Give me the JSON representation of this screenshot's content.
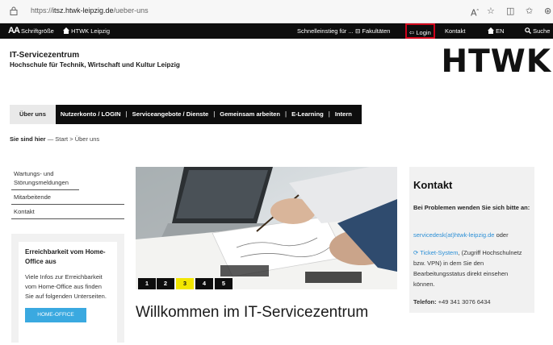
{
  "browser": {
    "url_prefix": "https://",
    "url_domain": "itsz.htwk-leipzig.de",
    "url_path": "/ueber-uns",
    "icons": [
      "lock-icon",
      "read-aloud-icon",
      "favorite-star-icon",
      "split-screen-icon",
      "favorites-icon",
      "extensions-icon"
    ]
  },
  "topbar": {
    "aa": "AA",
    "font_size_label": "Schriftgröße",
    "home_label": "HTWK Leipzig",
    "quick_start_label": "Schnelleinstieg für ...",
    "faculties_label": "Fakultäten",
    "login_label": "Login",
    "contact_label": "Kontakt",
    "language_label": "EN",
    "search_label": "Suche"
  },
  "header": {
    "title": "IT-Servicezentrum",
    "subtitle": "Hochschule für Technik, Wirtschaft und Kultur Leipzig",
    "logo_text": "HTWK"
  },
  "nav": {
    "items": [
      "Über uns",
      "Nutzerkonto / LOGIN",
      "Serviceangebote / Dienste",
      "Gemeinsam arbeiten",
      "E-Learning",
      "Intern"
    ],
    "separator": "|"
  },
  "breadcrumb": {
    "here": "Sie sind hier",
    "dash": "—",
    "start": "Start",
    "arrow": ">",
    "current": "Über uns"
  },
  "sidebar": {
    "links": [
      "Wartungs- und Störungsmeldungen",
      "Mitarbeitende",
      "Kontakt"
    ],
    "homeoffice": {
      "title": "Erreichbarkeit vom Home-Office aus",
      "text": "Viele Infos zur Erreichbarkeit vom Home-Office aus finden Sie auf folgenden Unterseiten.",
      "button": "HOME-OFFICE"
    }
  },
  "hero": {
    "slides": [
      "1",
      "2",
      "3",
      "4",
      "5"
    ],
    "active_slide": "3"
  },
  "main": {
    "heading": "Willkommen im IT-Servicezentrum"
  },
  "contact": {
    "title": "Kontakt",
    "lead": "Bei Problemen wenden Sie sich bitte an:",
    "email": "servicedesk(at)htwk-leipzig.de",
    "or": "oder",
    "ticket_link": "Ticket-System",
    "ticket_text": ", (Zugriff Hochschulnetz bzw. VPN) in dem Sie den Bearbeitungsstatus direkt einsehen können.",
    "phone_label": "Telefon:",
    "phone": "+49 341 3076 6434"
  },
  "colors": {
    "bar": "#0d0d0d",
    "highlight": "#d0021b",
    "accent_link": "#2b8fd6",
    "button": "#3aa9e0",
    "active_slide": "#f2e600"
  }
}
